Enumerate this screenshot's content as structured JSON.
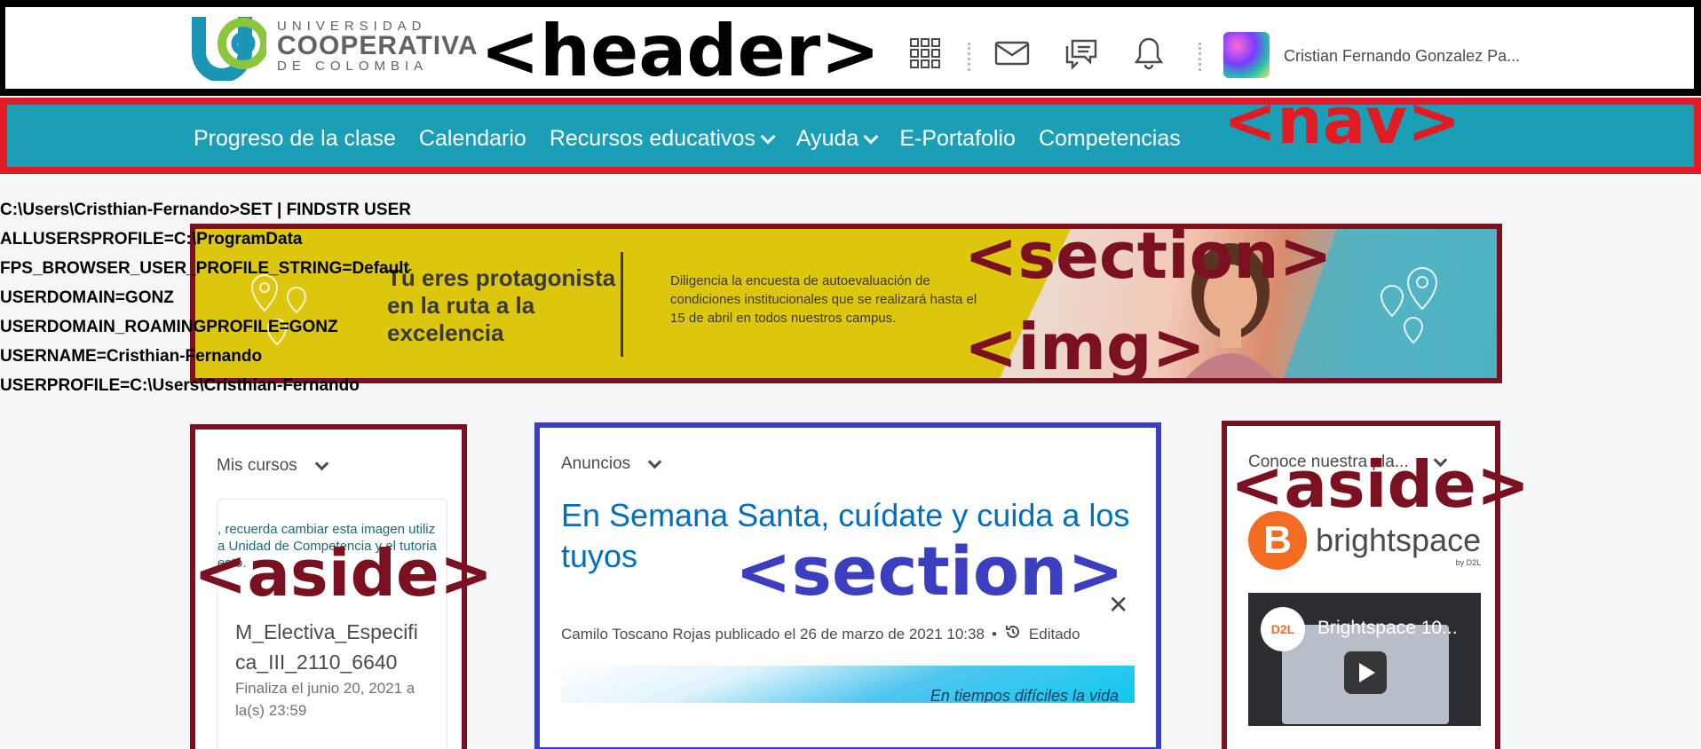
{
  "header": {
    "logo": {
      "line1": "UNIVERSIDAD",
      "line2": "COOPERATIVA",
      "line3": "DE COLOMBIA"
    },
    "tag": "<header>",
    "user_name": "Cristian Fernando Gonzalez Pa..."
  },
  "nav": {
    "tag": "<nav>",
    "items": [
      {
        "label": "Progreso de la clase"
      },
      {
        "label": "Calendario"
      },
      {
        "label": "Recursos educativos"
      },
      {
        "label": "Ayuda"
      },
      {
        "label": "E-Portafolio"
      },
      {
        "label": "Competencias"
      }
    ]
  },
  "terminal": {
    "lines": [
      "C:\\Users\\Cristhian-Fernando>SET | FINDSTR USER",
      "ALLUSERSPROFILE=C:\\ProgramData",
      "FPS_BROWSER_USER_PROFILE_STRING=Default",
      "USERDOMAIN=GONZ",
      "USERDOMAIN_ROAMINGPROFILE=GONZ",
      "USERNAME=Cristhian-Fernando",
      "USERPROFILE=C:\\Users\\Cristhian-Fernando"
    ]
  },
  "banner": {
    "tag_section": "<section>",
    "tag_img": "<img>",
    "title": [
      "Tú eres protagonista",
      "en la ruta a la",
      "excelencia"
    ],
    "text": [
      "Diligencia la encuesta de autoevaluación de",
      "condiciones institucionales que se realizará hasta el",
      "15 de abril en todos nuestros campus."
    ]
  },
  "widgets": {
    "left": {
      "tag": "<aside>",
      "title": "Mis cursos",
      "image_text": [
        ", recuerda cambiar esta imagen utiliz",
        "a Unidad de Competencia y el tutoria",
        "esto."
      ],
      "course_name": "M_Electiva_Especifica_III_2110_6640",
      "course_name_lines": [
        "M_Electiva_Especifi",
        "ca_III_2110_6640"
      ],
      "course_end": [
        "Finaliza el junio 20, 2021 a",
        "la(s) 23:59"
      ]
    },
    "middle": {
      "tag": "<section>",
      "title": "Anuncios",
      "announcement_title": "En Semana Santa, cuídate y cuida a los tuyos",
      "meta": "Camilo Toscano Rojas publicado el 26 de marzo de 2021 10:38",
      "edited": "Editado",
      "image_text": "En tiempos difíciles la vida"
    },
    "right": {
      "tag": "<aside>",
      "title": "Conoce nuestra pla...",
      "brand": "brightspace",
      "brand_sub": "by D2L",
      "video_badge": "D2L",
      "video_title": "Brightspace 10..."
    }
  },
  "colors": {
    "nav_bg": "#1a9fb6",
    "nav_outline": "#e11b22",
    "section_outline": "#7a1020",
    "main_section_outline": "#3b3fbf",
    "link": "#006fbf",
    "brightspace_orange": "#f26c22",
    "banner_yellow": "#dcc60e"
  }
}
